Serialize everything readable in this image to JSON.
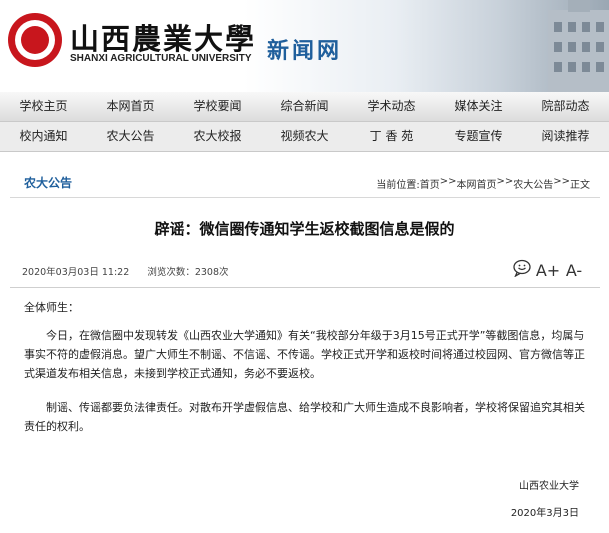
{
  "header": {
    "logo_cn": "山西農業大學",
    "logo_en": "SHANXI AGRICULTURAL UNIVERSITY",
    "site_name": "新闻网"
  },
  "nav_primary": [
    "学校主页",
    "本网首页",
    "学校要闻",
    "综合新闻",
    "学术动态",
    "媒体关注",
    "院部动态"
  ],
  "nav_secondary": [
    "校内通知",
    "农大公告",
    "农大校报",
    "视频农大",
    "丁 香 苑",
    "专题宣传",
    "阅读推荐"
  ],
  "section": {
    "title": "农大公告",
    "breadcrumb": {
      "prefix": "当前位置:",
      "home": "首页",
      "sep1": ">>",
      "level1": "本网首页",
      "sep2": ">>",
      "level2": "农大公告",
      "sep3": ">>",
      "level3": "正文"
    }
  },
  "article": {
    "title": "辟谣：微信圈传通知学生返校截图信息是假的",
    "date": "2020年03月03日 11:22",
    "views": "浏览次数：2308次",
    "tools": {
      "comment_icon": "comment-icon",
      "font_increase": "A+",
      "font_decrease": "A-"
    },
    "greeting": "全体师生：",
    "paragraphs": [
      "今日，在微信圈中发现转发《山西农业大学通知》有关“我校部分年级于3月15号正式开学”等截图信息，均属与事实不符的虚假消息。望广大师生不制谣、不信谣、不传谣。学校正式开学和返校时间将通过校园网、官方微信等正式渠道发布相关信息，未接到学校正式通知，务必不要返校。",
      "制谣、传谣都要负法律责任。对散布开学虚假信息、给学校和广大师生造成不良影响者，学校将保留追究其相关责任的权利。"
    ],
    "signature": "山西农业大学",
    "sign_date": "2020年3月3日"
  },
  "colors": {
    "brand_blue": "#1f5f9c",
    "seal_red": "#c8161d"
  }
}
